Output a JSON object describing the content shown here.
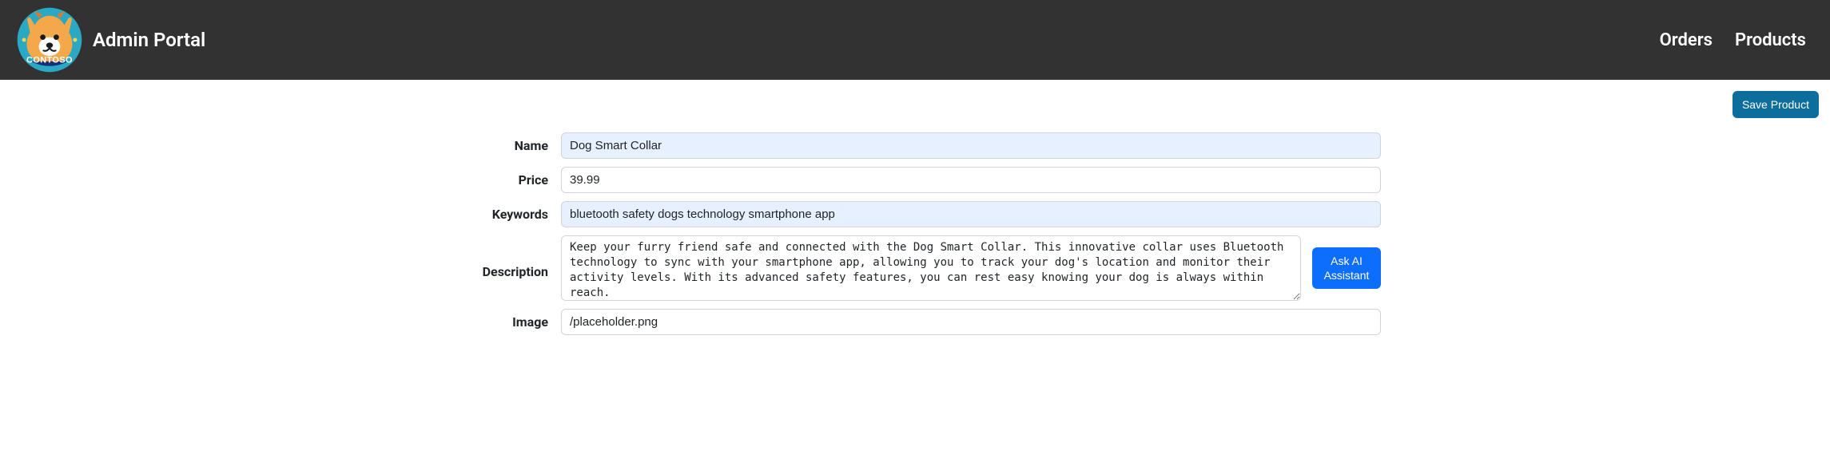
{
  "header": {
    "title": "Admin Portal",
    "nav": {
      "orders": "Orders",
      "products": "Products"
    }
  },
  "actions": {
    "save": "Save Product",
    "ask_ai": "Ask AI Assistant"
  },
  "form": {
    "labels": {
      "name": "Name",
      "price": "Price",
      "keywords": "Keywords",
      "description": "Description",
      "image": "Image"
    },
    "values": {
      "name": "Dog Smart Collar",
      "price": "39.99",
      "keywords": "bluetooth safety dogs technology smartphone app",
      "description": "Keep your furry friend safe and connected with the Dog Smart Collar. This innovative collar uses Bluetooth technology to sync with your smartphone app, allowing you to track your dog's location and monitor their activity levels. With its advanced safety features, you can rest easy knowing your dog is always within reach.",
      "image": "/placeholder.png"
    }
  },
  "colors": {
    "navbar_bg": "#323232",
    "save_btn_bg": "#0d6e9e",
    "ai_btn_bg": "#0d6efd",
    "field_highlight": "#e7f0fe"
  }
}
